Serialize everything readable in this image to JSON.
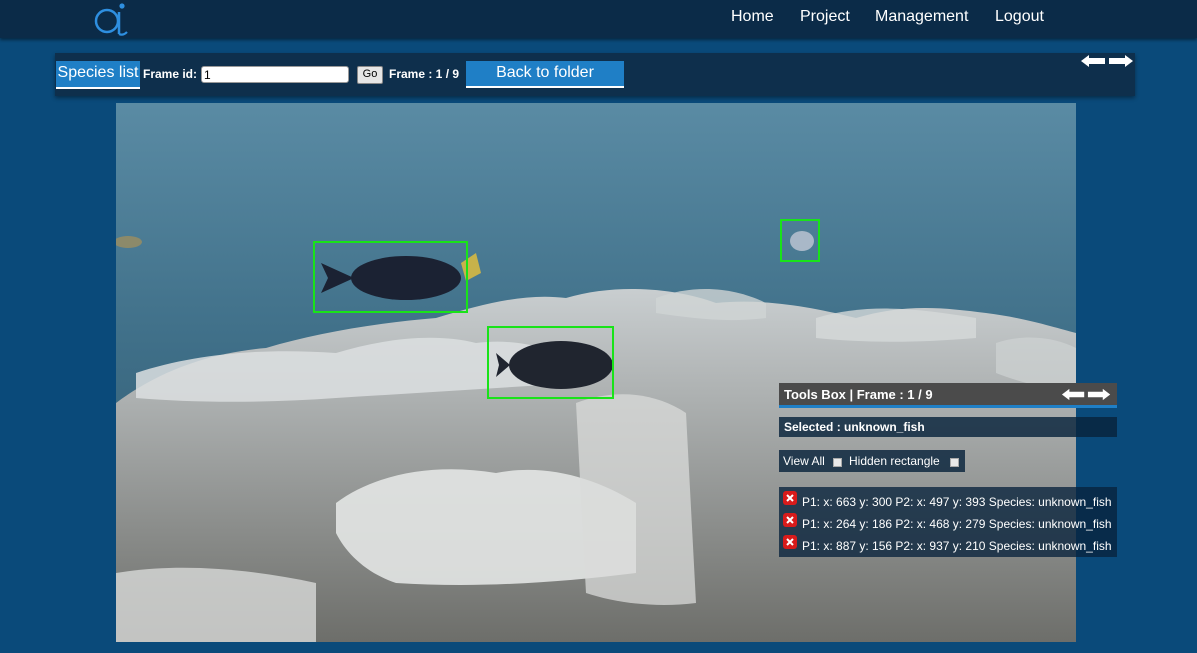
{
  "nav": {
    "home": "Home",
    "project": "Project",
    "management": "Management",
    "logout": "Logout"
  },
  "toolbar": {
    "species_list": "Species list",
    "frame_id_label": "Frame id:",
    "frame_id_value": "1",
    "go": "Go",
    "frame_counter": "Frame : 1 / 9",
    "back_to_folder": "Back to folder"
  },
  "tools_box": {
    "title": "Tools Box | Frame : 1 / 9",
    "selected": "Selected : unknown_fish",
    "view_all": "View All",
    "hidden_rectangle": "Hidden rectangle",
    "rectangles": [
      "P1: x: 663 y: 300 P2: x: 497 y: 393 Species: unknown_fish",
      "P1: x: 264 y: 186 P2: x: 468 y: 279 Species: unknown_fish",
      "P1: x: 887 y: 156 P2: x: 937 y: 210 Species: unknown_fish"
    ]
  },
  "icons": {
    "logo": "ai-logo-icon",
    "arrows": "left-right-arrows-icon",
    "delete": "delete-x-icon"
  },
  "colors": {
    "accent": "#1f7fc6",
    "box_green": "#19e319",
    "delete_red": "#d81b1b",
    "topbar": "#0b2b48",
    "background": "#0a4a7a"
  }
}
